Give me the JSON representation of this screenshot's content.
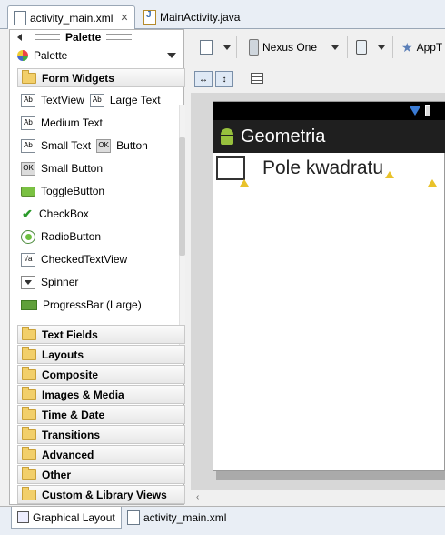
{
  "editor_tabs": [
    {
      "label": "activity_main.xml",
      "active": true
    },
    {
      "label": "MainActivity.java",
      "active": false
    }
  ],
  "palette": {
    "header": "Palette",
    "selector": "Palette",
    "open_category": "Form Widgets",
    "widgets": [
      {
        "label": "TextView",
        "icon": "textview-icon"
      },
      {
        "label": "Large Text",
        "icon": "textview-icon"
      },
      {
        "label": "Medium Text",
        "icon": "textview-icon"
      },
      {
        "label": "Small Text",
        "icon": "textview-icon"
      },
      {
        "label": "Button",
        "icon": "button-icon"
      },
      {
        "label": "Small Button",
        "icon": "button-icon"
      },
      {
        "label": "ToggleButton",
        "icon": "toggle-icon"
      },
      {
        "label": "CheckBox",
        "icon": "checkbox-icon"
      },
      {
        "label": "RadioButton",
        "icon": "radio-icon"
      },
      {
        "label": "CheckedTextView",
        "icon": "checked-textview-icon"
      },
      {
        "label": "Spinner",
        "icon": "spinner-icon"
      },
      {
        "label": "ProgressBar (Large)",
        "icon": "progressbar-icon"
      }
    ],
    "icon_text": {
      "textview": "Ab",
      "button": "OK",
      "checked": "√a"
    },
    "categories": [
      "Text Fields",
      "Layouts",
      "Composite",
      "Images & Media",
      "Time & Date",
      "Transitions",
      "Advanced",
      "Other",
      "Custom & Library Views"
    ]
  },
  "toolbar": {
    "device": "Nexus One",
    "theme": "AppT"
  },
  "preview": {
    "app_title": "Geometria",
    "label": "Pole kwadratu"
  },
  "bottom_tabs": [
    {
      "label": "Graphical Layout",
      "active": true
    },
    {
      "label": "activity_main.xml",
      "active": false
    }
  ],
  "colors": {
    "action_bar": "#1f1f1f",
    "android_green": "#97c03d",
    "warning": "#e9c22a"
  }
}
